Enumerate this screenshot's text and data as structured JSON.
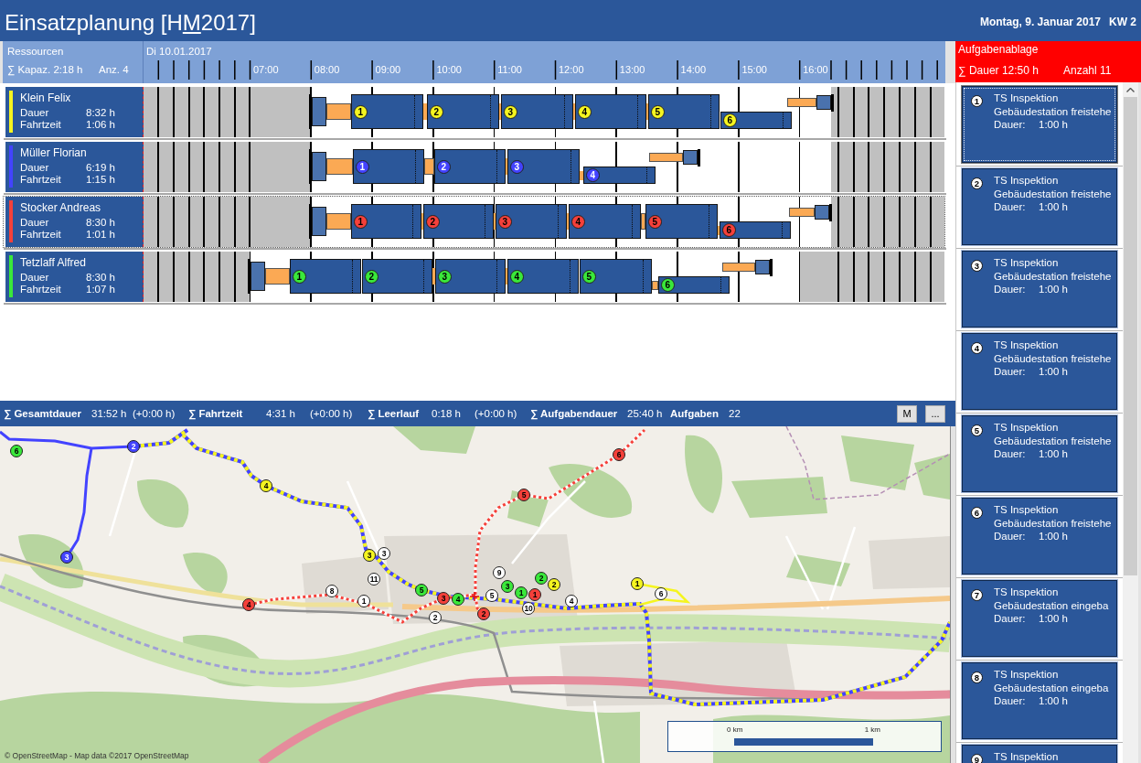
{
  "header": {
    "title": {
      "before": "Einsatzplanung [H",
      "underlined": "M",
      "after": "2017]"
    },
    "date": "Montag, 9. Januar 2017",
    "week": "KW 2"
  },
  "resource_header": {
    "title": "Ressourcen",
    "capacity": "∑ Kapaz. 2:18 h",
    "count": "Anz. 4"
  },
  "timeline": {
    "date": "Di 10.01.2017",
    "hours": [
      "07:00",
      "08:00",
      "09:00",
      "10:00",
      "11:00",
      "12:00",
      "13:00",
      "14:00",
      "15:00",
      "16:00"
    ]
  },
  "resources": [
    {
      "name": "Klein Felix",
      "color": "#f5f520",
      "selected": false,
      "duration_label": "Dauer",
      "duration": "8:32 h",
      "travel_label": "Fahrtzeit",
      "travel": "1:06 h",
      "tasks": [
        {
          "number": "1"
        },
        {
          "number": "2"
        },
        {
          "number": "3"
        },
        {
          "number": "4"
        },
        {
          "number": "5"
        },
        {
          "number": "6"
        }
      ]
    },
    {
      "name": "Müller Florian",
      "color": "#4343ff",
      "selected": false,
      "duration_label": "Dauer",
      "duration": "6:19 h",
      "travel_label": "Fahrtzeit",
      "travel": "1:15 h",
      "tasks": [
        {
          "number": "1"
        },
        {
          "number": "2"
        },
        {
          "number": "3"
        },
        {
          "number": "4"
        }
      ]
    },
    {
      "name": "Stocker Andreas",
      "color": "#f5403a",
      "selected": true,
      "duration_label": "Dauer",
      "duration": "8:30 h",
      "travel_label": "Fahrtzeit",
      "travel": "1:01 h",
      "tasks": [
        {
          "number": "1"
        },
        {
          "number": "2"
        },
        {
          "number": "3"
        },
        {
          "number": "4"
        },
        {
          "number": "5"
        },
        {
          "number": "6"
        }
      ]
    },
    {
      "name": "Tetzlaff Alfred",
      "color": "#3ae83a",
      "selected": false,
      "duration_label": "Dauer",
      "duration": "8:30 h",
      "travel_label": "Fahrtzeit",
      "travel": "1:07 h",
      "tasks": [
        {
          "number": "1"
        },
        {
          "number": "2"
        },
        {
          "number": "3"
        },
        {
          "number": "4"
        },
        {
          "number": "5"
        },
        {
          "number": "6"
        }
      ]
    }
  ],
  "summary": {
    "items": [
      {
        "label": "∑ Gesamtdauer",
        "value": "31:52 h",
        "delta": "(+0:00 h)"
      },
      {
        "label": "∑ Fahrtzeit",
        "value": "4:31 h",
        "delta": "(+0:00 h)"
      },
      {
        "label": "∑ Leerlauf",
        "value": "0:18 h",
        "delta": "(+0:00 h)"
      },
      {
        "label": "∑ Aufgabendauer",
        "value": "25:40 h"
      },
      {
        "label": "Aufgaben",
        "value": "22"
      }
    ],
    "buttons": [
      "M",
      "..."
    ]
  },
  "map": {
    "markers": [
      {
        "number": "6",
        "color": "#3ae83a"
      },
      {
        "number": "2",
        "color": "#4343ff"
      },
      {
        "number": "6",
        "color": "#f5403a"
      },
      {
        "number": "4",
        "color": "#f5f520"
      },
      {
        "number": "5",
        "color": "#f5403a"
      },
      {
        "number": "3",
        "color": "#4343ff"
      },
      {
        "number": "3",
        "color": "#f5f520"
      },
      {
        "number": "3",
        "color": "#ffffff"
      },
      {
        "number": "11",
        "color": "#ffffff"
      },
      {
        "number": "9",
        "color": "#ffffff"
      },
      {
        "number": "3",
        "color": "#3ae83a"
      },
      {
        "number": "2",
        "color": "#3ae83a"
      },
      {
        "number": "2",
        "color": "#f5f520"
      },
      {
        "number": "1",
        "color": "#f5f520"
      },
      {
        "number": "8",
        "color": "#ffffff"
      },
      {
        "number": "1",
        "color": "#ffffff"
      },
      {
        "number": "5",
        "color": "#3ae83a"
      },
      {
        "number": "3",
        "color": "#f5403a"
      },
      {
        "number": "4",
        "color": "#3ae83a"
      },
      {
        "number": "5",
        "color": "#ffffff"
      },
      {
        "number": "1",
        "color": "#3ae83a"
      },
      {
        "number": "1",
        "color": "#f5403a"
      },
      {
        "number": "4",
        "color": "#ffffff"
      },
      {
        "number": "6",
        "color": "#ffffff"
      },
      {
        "number": "4",
        "color": "#f5403a"
      },
      {
        "number": "2",
        "color": "#ffffff"
      },
      {
        "number": "2",
        "color": "#f5403a"
      },
      {
        "number": "10",
        "color": "#ffffff"
      }
    ],
    "scale": {
      "start": "0 km",
      "end": "1 km"
    },
    "attribution": "© OpenStreetMap - Map data ©2017 OpenStreetMap"
  },
  "task_tray": {
    "title": "Aufgabenablage",
    "duration": "∑ Dauer 12:50 h",
    "count": "Anzahl 11",
    "cards": [
      {
        "number": "1",
        "title": "TS Inspektion",
        "subtitle": "Gebäudestation freistehe",
        "duration_label": "Dauer:",
        "duration": "1:00 h",
        "selected": true
      },
      {
        "number": "2",
        "title": "TS Inspektion",
        "subtitle": "Gebäudestation freistehe",
        "duration_label": "Dauer:",
        "duration": "1:00 h",
        "selected": false
      },
      {
        "number": "3",
        "title": "TS Inspektion",
        "subtitle": "Gebäudestation freistehe",
        "duration_label": "Dauer:",
        "duration": "1:00 h",
        "selected": false
      },
      {
        "number": "4",
        "title": "TS Inspektion",
        "subtitle": "Gebäudestation freistehe",
        "duration_label": "Dauer:",
        "duration": "1:00 h",
        "selected": false
      },
      {
        "number": "5",
        "title": "TS Inspektion",
        "subtitle": "Gebäudestation freistehe",
        "duration_label": "Dauer:",
        "duration": "1:00 h",
        "selected": false
      },
      {
        "number": "6",
        "title": "TS Inspektion",
        "subtitle": "Gebäudestation freistehe",
        "duration_label": "Dauer:",
        "duration": "1:00 h",
        "selected": false
      },
      {
        "number": "7",
        "title": "TS Inspektion",
        "subtitle": "Gebäudestation eingeba",
        "duration_label": "Dauer:",
        "duration": "1:00 h",
        "selected": false
      },
      {
        "number": "8",
        "title": "TS Inspektion",
        "subtitle": "Gebäudestation eingeba",
        "duration_label": "Dauer:",
        "duration": "1:00 h",
        "selected": false
      },
      {
        "number": "9",
        "title": "TS Inspektion",
        "selected": false
      }
    ]
  }
}
